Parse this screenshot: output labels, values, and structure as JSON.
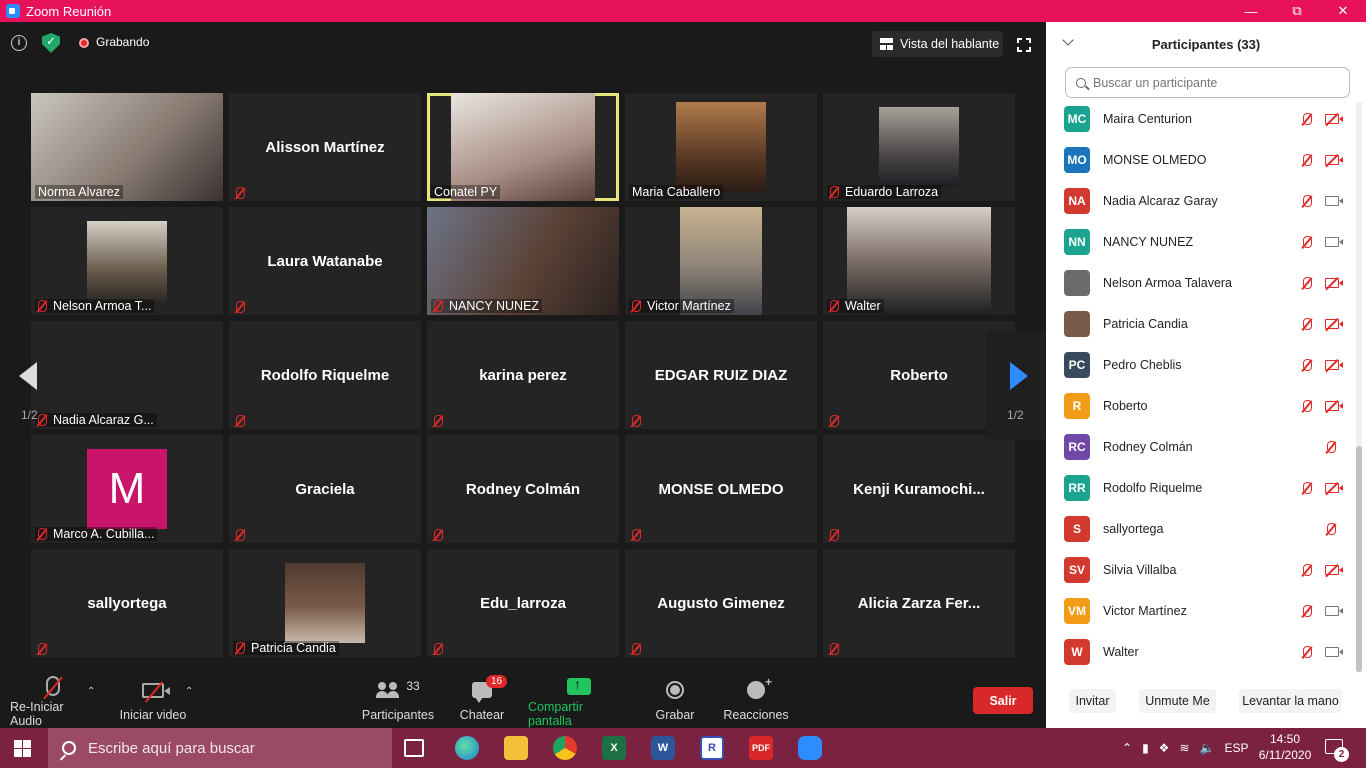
{
  "window": {
    "title": "Zoom Reunión"
  },
  "topbar": {
    "recording_label": "Grabando",
    "speaker_view_label": "Vista del hablante"
  },
  "pagination": {
    "left": "1/2",
    "right": "1/2"
  },
  "tiles": [
    {
      "name": "Norma Alvarez",
      "type": "video",
      "muted": false
    },
    {
      "name": "Alisson Martínez",
      "type": "name",
      "muted": true
    },
    {
      "name": "Conatel PY",
      "type": "video",
      "muted": false,
      "active": true
    },
    {
      "name": "Maria Caballero",
      "type": "video",
      "muted": false
    },
    {
      "name": "Eduardo Larroza",
      "type": "video",
      "muted": true
    },
    {
      "name": "Nelson Armoa T...",
      "type": "video",
      "muted": true
    },
    {
      "name": "Laura Watanabe",
      "type": "name",
      "muted": true
    },
    {
      "name": "NANCY NUNEZ",
      "type": "video",
      "muted": true
    },
    {
      "name": "Victor Martínez",
      "type": "video",
      "muted": true
    },
    {
      "name": "Walter",
      "type": "video",
      "muted": true
    },
    {
      "name": "Nadia Alcaraz G...",
      "type": "blank",
      "muted": true
    },
    {
      "name": "Rodolfo Riquelme",
      "type": "name",
      "muted": true
    },
    {
      "name": "karina perez",
      "type": "name",
      "muted": true
    },
    {
      "name": "EDGAR RUIZ DIAZ",
      "type": "name",
      "muted": true
    },
    {
      "name": "Roberto",
      "type": "name",
      "muted": true
    },
    {
      "name": "Marco A. Cubilla...",
      "type": "avatar",
      "initial": "M",
      "muted": true
    },
    {
      "name": "Graciela",
      "type": "name",
      "muted": true
    },
    {
      "name": "Rodney Colmán",
      "type": "name",
      "muted": true
    },
    {
      "name": "MONSE OLMEDO",
      "type": "name",
      "muted": true
    },
    {
      "name": "Kenji  Kuramochi...",
      "type": "name",
      "muted": true
    },
    {
      "name": "sallyortega",
      "type": "name",
      "muted": true
    },
    {
      "name": "Patricia Candia",
      "type": "video",
      "muted": true
    },
    {
      "name": "Edu_larroza",
      "type": "name",
      "muted": true
    },
    {
      "name": "Augusto Gimenez",
      "type": "name",
      "muted": true
    },
    {
      "name": "Alicia  Zarza  Fer...",
      "type": "name",
      "muted": true
    }
  ],
  "toolbar": {
    "audio_label": "Re-Iniciar Audio",
    "video_label": "Iniciar video",
    "participants_label": "Participantes",
    "participants_count": "33",
    "chat_label": "Chatear",
    "chat_badge": "16",
    "share_label": "Compartir pantalla",
    "record_label": "Grabar",
    "reactions_label": "Reacciones",
    "leave_label": "Salir"
  },
  "panel": {
    "title": "Participantes (33)",
    "search_placeholder": "Buscar un participante",
    "participants": [
      {
        "initials": "MC",
        "name": "Maira Centurion",
        "color": "#1aa38e",
        "cam": "off"
      },
      {
        "initials": "MO",
        "name": "MONSE OLMEDO",
        "color": "#1b75bb",
        "cam": "off"
      },
      {
        "initials": "NA",
        "name": "Nadia Alcaraz Garay",
        "color": "#d23a30",
        "cam": "on"
      },
      {
        "initials": "NN",
        "name": "NANCY NUNEZ",
        "color": "#1aa38e",
        "cam": "on"
      },
      {
        "initials": "",
        "name": "Nelson Armoa Talavera",
        "color": "#6b6b6b",
        "cam": "off"
      },
      {
        "initials": "",
        "name": "Patricia Candia",
        "color": "#7a5b4a",
        "cam": "off"
      },
      {
        "initials": "PC",
        "name": "Pedro Cheblis",
        "color": "#3a4a5e",
        "cam": "off"
      },
      {
        "initials": "R",
        "name": "Roberto",
        "color": "#f29b16",
        "cam": "off"
      },
      {
        "initials": "RC",
        "name": "Rodney Colmán",
        "color": "#7048a8",
        "cam": "none"
      },
      {
        "initials": "RR",
        "name": "Rodolfo Riquelme",
        "color": "#1aa38e",
        "cam": "off"
      },
      {
        "initials": "S",
        "name": "sallyortega",
        "color": "#d23a30",
        "cam": "none"
      },
      {
        "initials": "SV",
        "name": "Silvia Villalba",
        "color": "#d23a30",
        "cam": "off"
      },
      {
        "initials": "VM",
        "name": "Victor Martínez",
        "color": "#f29b16",
        "cam": "on"
      },
      {
        "initials": "W",
        "name": "Walter",
        "color": "#d23a30",
        "cam": "on"
      }
    ],
    "invite_label": "Invitar",
    "unmute_label": "Unmute Me",
    "raise_hand_label": "Levantar la mano"
  },
  "taskbar": {
    "search_placeholder": "Escribe aquí para buscar",
    "language": "ESP",
    "time": "14:50",
    "date": "6/11/2020",
    "notifications": "2"
  }
}
